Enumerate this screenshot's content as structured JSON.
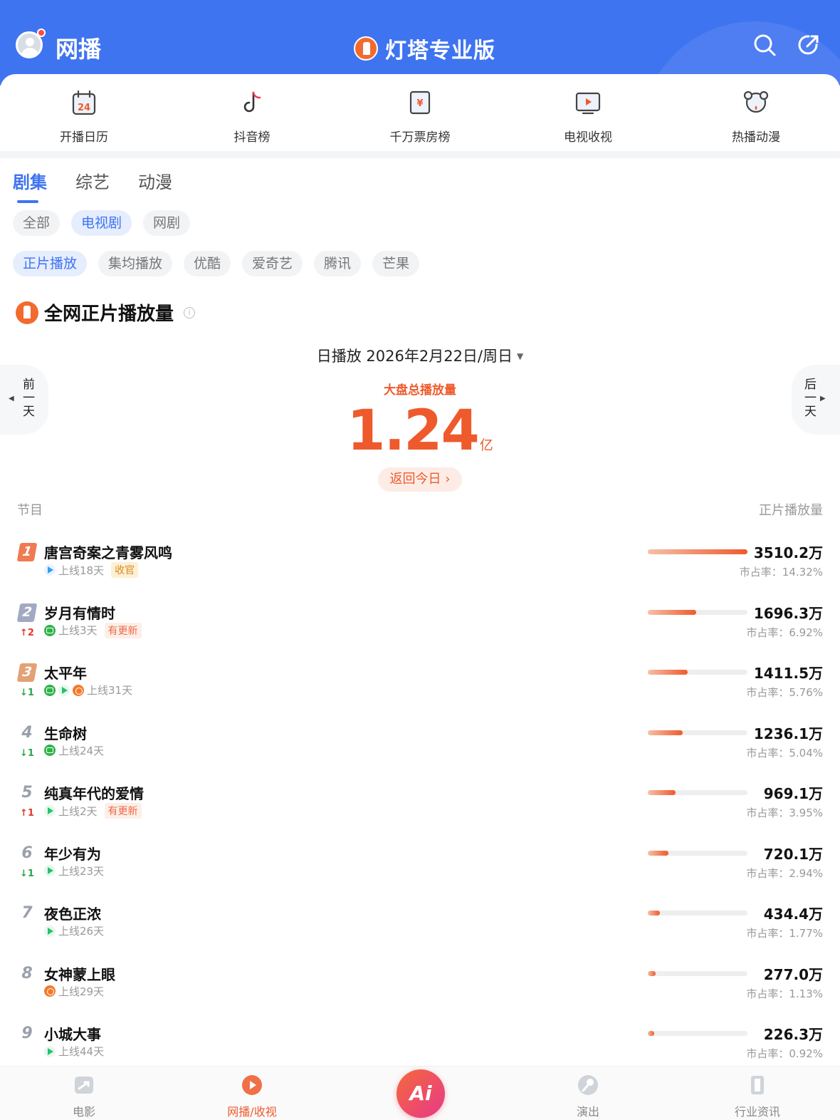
{
  "header": {
    "title": "网播",
    "brand": "灯塔专业版",
    "accent": "#3f74f0"
  },
  "quick_nav": [
    {
      "label": "开播日历",
      "icon": "calendar-icon"
    },
    {
      "label": "抖音榜",
      "icon": "tiktok-icon"
    },
    {
      "label": "千万票房榜",
      "icon": "ticket-icon"
    },
    {
      "label": "电视收视",
      "icon": "tv-icon"
    },
    {
      "label": "热播动漫",
      "icon": "anime-icon"
    }
  ],
  "calendar_day": "24",
  "tabs": [
    "剧集",
    "综艺",
    "动漫"
  ],
  "active_tab": "剧集",
  "type_filters": [
    "全部",
    "电视剧",
    "网剧"
  ],
  "active_type": "电视剧",
  "metric_filters": [
    "正片播放",
    "集均播放",
    "优酷",
    "爱奇艺",
    "腾讯",
    "芒果"
  ],
  "active_metric": "正片播放",
  "section_title": "全网正片播放量",
  "date_label": "日播放 2026年2月22日/周日",
  "prev_day": "前一天",
  "next_day": "后一天",
  "total": {
    "label": "大盘总播放量",
    "value": "1.24",
    "unit": "亿"
  },
  "back_today": "返回今日 ›",
  "columns": {
    "left": "节目",
    "right": "正片播放量"
  },
  "rows": [
    {
      "rank": "1",
      "title": "唐宫奇案之青雾风鸣",
      "change": "",
      "platforms": [
        "tencent"
      ],
      "online": "上线18天",
      "tag": "收官",
      "tag_type": "end",
      "amount": "3510.2万",
      "share": "市占率：14.32%",
      "share_pct": 14.32
    },
    {
      "rank": "2",
      "title": "岁月有情时",
      "change": "↑2",
      "change_dir": "up",
      "platforms": [
        "iqiyi"
      ],
      "online": "上线3天",
      "tag": "有更新",
      "tag_type": "upd",
      "amount": "1696.3万",
      "share": "市占率：6.92%",
      "share_pct": 6.92
    },
    {
      "rank": "3",
      "title": "太平年",
      "change": "↓1",
      "change_dir": "down",
      "platforms": [
        "iqiyi",
        "youku",
        "mango"
      ],
      "online": "上线31天",
      "tag": "",
      "amount": "1411.5万",
      "share": "市占率：5.76%",
      "share_pct": 5.76
    },
    {
      "rank": "4",
      "title": "生命树",
      "change": "↓1",
      "change_dir": "down",
      "platforms": [
        "iqiyi"
      ],
      "online": "上线24天",
      "tag": "",
      "amount": "1236.1万",
      "share": "市占率：5.04%",
      "share_pct": 5.04
    },
    {
      "rank": "5",
      "title": "纯真年代的爱情",
      "change": "↑1",
      "change_dir": "up",
      "platforms": [
        "youku"
      ],
      "online": "上线2天",
      "tag": "有更新",
      "tag_type": "upd",
      "amount": "969.1万",
      "share": "市占率：3.95%",
      "share_pct": 3.95
    },
    {
      "rank": "6",
      "title": "年少有为",
      "change": "↓1",
      "change_dir": "down",
      "platforms": [
        "youku"
      ],
      "online": "上线23天",
      "tag": "",
      "amount": "720.1万",
      "share": "市占率：2.94%",
      "share_pct": 2.94
    },
    {
      "rank": "7",
      "title": "夜色正浓",
      "change": "",
      "platforms": [
        "youku"
      ],
      "online": "上线26天",
      "tag": "",
      "amount": "434.4万",
      "share": "市占率：1.77%",
      "share_pct": 1.77
    },
    {
      "rank": "8",
      "title": "女神蒙上眼",
      "change": "",
      "platforms": [
        "mango"
      ],
      "online": "上线29天",
      "tag": "",
      "amount": "277.0万",
      "share": "市占率：1.13%",
      "share_pct": 1.13
    },
    {
      "rank": "9",
      "title": "小城大事",
      "change": "",
      "platforms": [
        "youku"
      ],
      "online": "上线44天",
      "tag": "",
      "amount": "226.3万",
      "share": "市占率：0.92%",
      "share_pct": 0.92
    }
  ],
  "bottom_nav": [
    {
      "label": "电影",
      "icon": "movie-icon"
    },
    {
      "label": "网播/收视",
      "icon": "play-icon"
    },
    {
      "label": "演出",
      "icon": "mic-icon"
    },
    {
      "label": "行业资讯",
      "icon": "news-icon"
    }
  ],
  "active_bottom": "网播/收视",
  "ai_label": "Ai"
}
